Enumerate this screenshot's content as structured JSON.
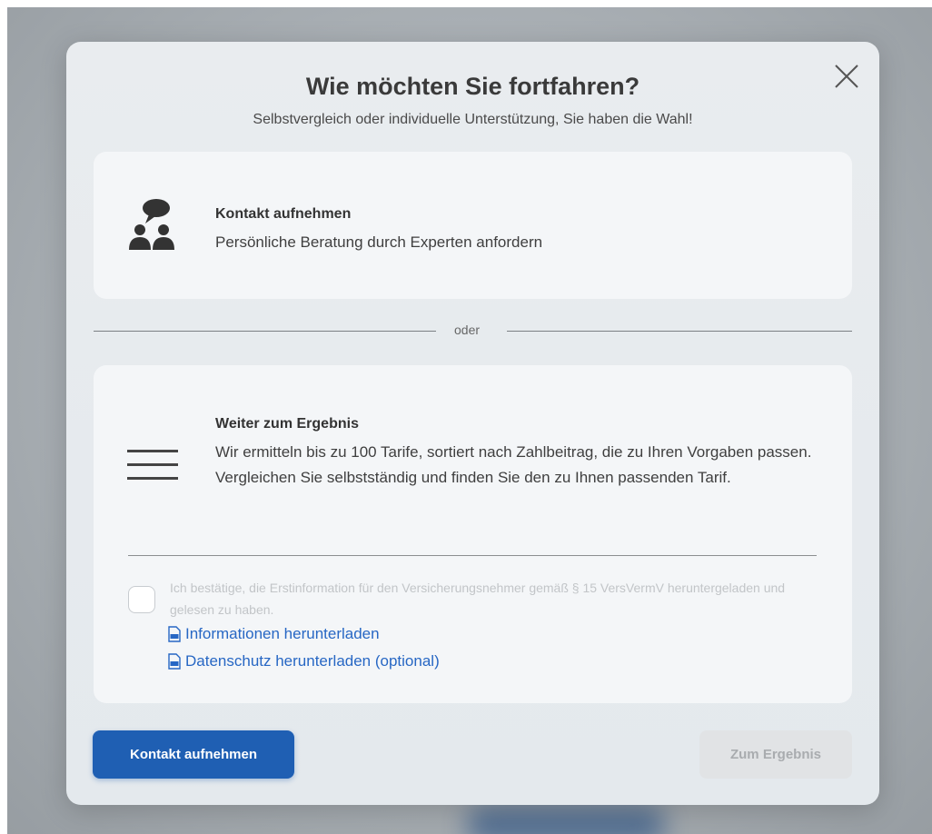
{
  "dialog": {
    "title": "Wie möchten Sie fortfahren?",
    "subtitle": "Selbstvergleich oder individuelle Unterstützung, Sie haben die Wahl!"
  },
  "contact_option": {
    "icon": "people-chat-icon",
    "heading": "Kontakt aufnehmen",
    "text": "Persönliche Beratung durch Experten anfordern"
  },
  "separator": {
    "label": "oder"
  },
  "result_option": {
    "icon": "hamburger-lines-icon",
    "heading": "Weiter zum Ergebnis",
    "text": "Wir ermitteln bis zu 100 Tarife, sortiert nach Zahlbeitrag, die zu Ihren Vorgaben passen. Vergleichen Sie selbstständig und finden Sie den zu Ihnen passenden Tarif.",
    "consent": {
      "checked": false,
      "text": "Ich bestätige, die Erstinformation für den Versicherungsnehmer gemäß § 15 VersVermV heruntergeladen und gelesen zu haben."
    },
    "links": [
      {
        "label": "Informationen herunterladen",
        "icon": "pdf-file-icon"
      },
      {
        "label": "Datenschutz herunterladen (optional)",
        "icon": "pdf-file-icon"
      }
    ]
  },
  "buttons": {
    "contact_label": "Kontakt aufnehmen",
    "result_label": "Zum Ergebnis",
    "result_disabled": true
  },
  "colors": {
    "primary": "#1f5fb3",
    "link": "#2767c4",
    "disabled_bg": "#e1e3e5",
    "disabled_text": "#a9acaf",
    "text_dark": "#333333"
  }
}
